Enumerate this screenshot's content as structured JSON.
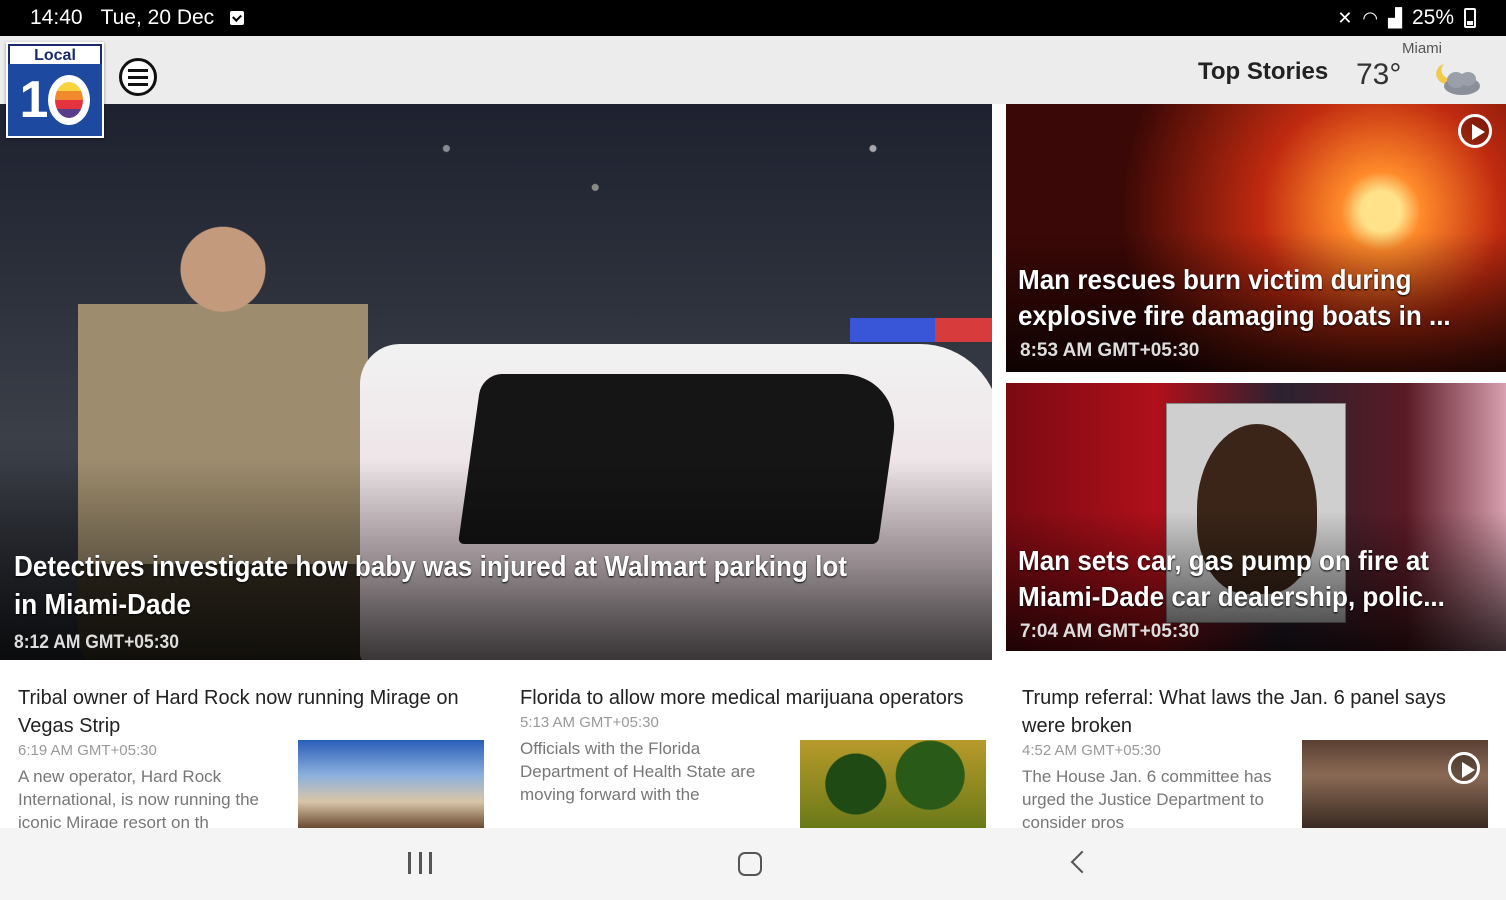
{
  "status_bar": {
    "time": "14:40",
    "date": "Tue, 20 Dec",
    "battery": "25%",
    "icons": [
      "notification-check-icon",
      "mute-icon",
      "wifi-icon",
      "signal-icon",
      "battery-icon"
    ]
  },
  "header": {
    "logo_top": "Local",
    "logo_number": "1",
    "section_label": "Top Stories",
    "weather": {
      "city": "Miami",
      "temperature": "73°",
      "icon": "night-cloud-icon"
    }
  },
  "hero": {
    "headline": "Detectives investigate how baby was injured at Walmart parking lot in Miami-Dade",
    "time": "8:12 AM GMT+05:30"
  },
  "side_stories": [
    {
      "headline_line1": "Man rescues burn victim during",
      "headline_line2": "explosive fire damaging boats in ...",
      "time": "8:53 AM GMT+05:30",
      "has_video": true
    },
    {
      "headline_line1": "Man sets car, gas pump on fire at",
      "headline_line2": "Miami-Dade car dealership, polic...",
      "time": "7:04 AM GMT+05:30",
      "has_video": false
    }
  ],
  "articles": [
    {
      "title": "Tribal owner of Hard Rock now running Mirage on Vegas Strip",
      "time": "6:19 AM GMT+05:30",
      "summary": "A new operator, Hard Rock International, is now running the iconic Mirage resort on th"
    },
    {
      "title": "Florida to allow more medical marijuana operators",
      "time": "5:13 AM GMT+05:30",
      "summary": "Officials with the Florida Department of Health State are moving forward with the"
    },
    {
      "title": "Trump referral: What laws the Jan. 6 panel says were broken",
      "time": "4:52 AM GMT+05:30",
      "summary": "The House Jan. 6 committee has urged the Justice Department to consider pros"
    }
  ],
  "colors": {
    "status_bar": "#000000",
    "header": "#ececec",
    "logo_blue": "#1d4aa0",
    "nav_bar": "#f4f4f4"
  }
}
